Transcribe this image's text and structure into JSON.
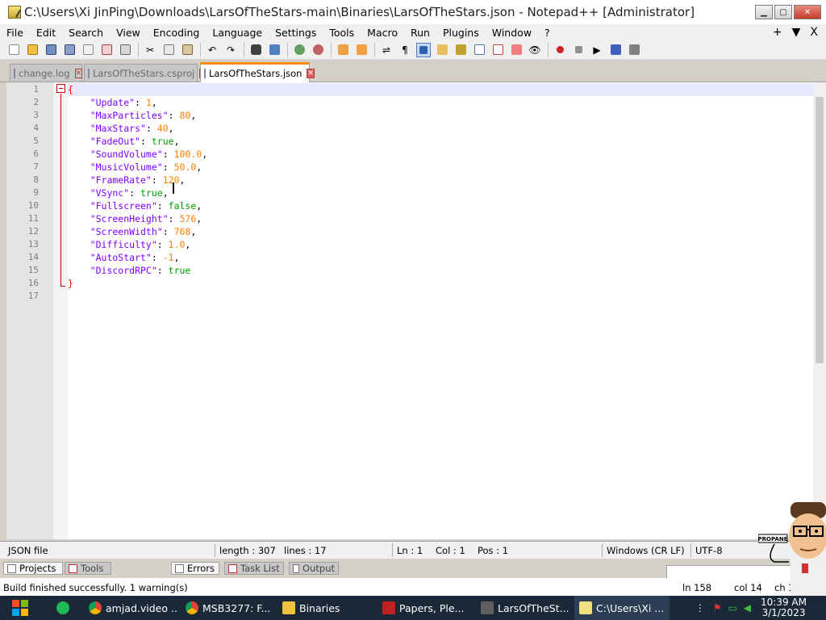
{
  "window": {
    "title": "C:\\Users\\Xi JinPing\\Downloads\\LarsOfTheStars-main\\Binaries\\LarsOfTheStars.json - Notepad++ [Administrator]"
  },
  "menu": {
    "items": [
      "File",
      "Edit",
      "Search",
      "View",
      "Encoding",
      "Language",
      "Settings",
      "Tools",
      "Macro",
      "Run",
      "Plugins",
      "Window",
      "?"
    ],
    "right": [
      "+",
      "▼",
      "X"
    ]
  },
  "tabs": [
    {
      "label": "change.log",
      "active": false
    },
    {
      "label": "LarsOfTheStars.csproj",
      "active": false
    },
    {
      "label": "LarsOfTheStars.json",
      "active": true
    }
  ],
  "code": {
    "lines": [
      [
        {
          "t": "{",
          "c": "brace"
        }
      ],
      [
        {
          "t": "    \"Update\"",
          "c": "key"
        },
        {
          "t": ": ",
          "c": "punc"
        },
        {
          "t": "1",
          "c": "num"
        },
        {
          "t": ",",
          "c": "punc"
        }
      ],
      [
        {
          "t": "    \"MaxParticles\"",
          "c": "key"
        },
        {
          "t": ": ",
          "c": "punc"
        },
        {
          "t": "80",
          "c": "num"
        },
        {
          "t": ",",
          "c": "punc"
        }
      ],
      [
        {
          "t": "    \"MaxStars\"",
          "c": "key"
        },
        {
          "t": ": ",
          "c": "punc"
        },
        {
          "t": "40",
          "c": "num"
        },
        {
          "t": ",",
          "c": "punc"
        }
      ],
      [
        {
          "t": "    \"FadeOut\"",
          "c": "key"
        },
        {
          "t": ": ",
          "c": "punc"
        },
        {
          "t": "true",
          "c": "bool"
        },
        {
          "t": ",",
          "c": "punc"
        }
      ],
      [
        {
          "t": "    \"SoundVolume\"",
          "c": "key"
        },
        {
          "t": ": ",
          "c": "punc"
        },
        {
          "t": "100.0",
          "c": "num"
        },
        {
          "t": ",",
          "c": "punc"
        }
      ],
      [
        {
          "t": "    \"MusicVolume\"",
          "c": "key"
        },
        {
          "t": ": ",
          "c": "punc"
        },
        {
          "t": "50.0",
          "c": "num"
        },
        {
          "t": ",",
          "c": "punc"
        }
      ],
      [
        {
          "t": "    \"FrameRate\"",
          "c": "key"
        },
        {
          "t": ": ",
          "c": "punc"
        },
        {
          "t": "120",
          "c": "num"
        },
        {
          "t": ",",
          "c": "punc"
        }
      ],
      [
        {
          "t": "    \"VSync\"",
          "c": "key"
        },
        {
          "t": ": ",
          "c": "punc"
        },
        {
          "t": "true",
          "c": "bool"
        },
        {
          "t": ",",
          "c": "punc"
        }
      ],
      [
        {
          "t": "    \"Fullscreen\"",
          "c": "key"
        },
        {
          "t": ": ",
          "c": "punc"
        },
        {
          "t": "false",
          "c": "bool"
        },
        {
          "t": ",",
          "c": "punc"
        }
      ],
      [
        {
          "t": "    \"ScreenHeight\"",
          "c": "key"
        },
        {
          "t": ": ",
          "c": "punc"
        },
        {
          "t": "576",
          "c": "num"
        },
        {
          "t": ",",
          "c": "punc"
        }
      ],
      [
        {
          "t": "    \"ScreenWidth\"",
          "c": "key"
        },
        {
          "t": ": ",
          "c": "punc"
        },
        {
          "t": "768",
          "c": "num"
        },
        {
          "t": ",",
          "c": "punc"
        }
      ],
      [
        {
          "t": "    \"Difficulty\"",
          "c": "key"
        },
        {
          "t": ": ",
          "c": "punc"
        },
        {
          "t": "1.0",
          "c": "num"
        },
        {
          "t": ",",
          "c": "punc"
        }
      ],
      [
        {
          "t": "    \"AutoStart\"",
          "c": "key"
        },
        {
          "t": ": ",
          "c": "punc"
        },
        {
          "t": "-1",
          "c": "num"
        },
        {
          "t": ",",
          "c": "punc"
        }
      ],
      [
        {
          "t": "    \"DiscordRPC\"",
          "c": "key"
        },
        {
          "t": ": ",
          "c": "punc"
        },
        {
          "t": "true",
          "c": "bool"
        }
      ],
      [
        {
          "t": "}",
          "c": "brace"
        }
      ],
      []
    ]
  },
  "status": {
    "filetype": "JSON file",
    "length": "length : 307",
    "lines": "lines : 17",
    "ln": "Ln : 1",
    "col": "Col : 1",
    "pos": "Pos : 1",
    "eol": "Windows (CR LF)",
    "encoding": "UTF-8"
  },
  "panel_tabs": [
    {
      "label": "Projects",
      "active": true
    },
    {
      "label": "Tools",
      "active": false
    },
    {
      "label": "Errors",
      "active": true
    },
    {
      "label": "Task List",
      "active": false
    },
    {
      "label": "Output",
      "active": false
    }
  ],
  "output": {
    "message": "Build finished successfully. 1 warning(s)",
    "ln": "ln 158",
    "col": "col 14",
    "ch": "ch 14"
  },
  "taskbar": {
    "items": [
      {
        "label": "amjad.video ...",
        "color": "#e8a020"
      },
      {
        "label": "MSB3277: F...",
        "color": "#e8a020"
      },
      {
        "label": "Binaries",
        "color": "#f0c040"
      },
      {
        "label": "Papers, Ple...",
        "color": "#c02020"
      },
      {
        "label": "LarsOfTheSt...",
        "color": "#606060"
      },
      {
        "label": "C:\\Users\\Xi ...",
        "color": "#f0e080"
      }
    ],
    "time": "10:39 AM",
    "date": "3/1/2023"
  },
  "mascot": {
    "label": "PROPANE"
  },
  "colors": {
    "key": "#8000ff",
    "number": "#ff8000",
    "bool": "#00a000",
    "brace": "#ff0000",
    "tab_accent": "#fa8e0f"
  }
}
